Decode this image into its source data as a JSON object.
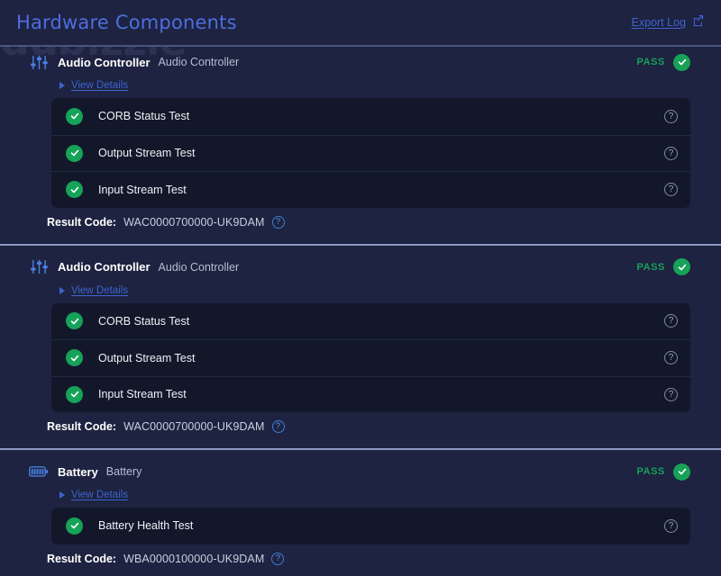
{
  "watermark": {
    "text": "dubizzle"
  },
  "header": {
    "title": "Hardware Components",
    "export_label": "Export Log",
    "export_icon": "external-link-icon"
  },
  "colors": {
    "background": "#1d2340",
    "panel": "#121829",
    "accent_link": "#3f63cf",
    "title": "#4f6de0",
    "pass_green": "#17a257",
    "divider": "#8e9ac4"
  },
  "labels": {
    "result_code_label": "Result Code:",
    "view_details": "View Details",
    "help_glyph": "?"
  },
  "components": [
    {
      "icon": "sliders-icon",
      "name": "Audio Controller",
      "type": "Audio Controller",
      "status": "PASS",
      "result_code": "WAC0000700000-UK9DAM",
      "tests": [
        {
          "name": "CORB Status Test",
          "status": "PASS"
        },
        {
          "name": "Output Stream Test",
          "status": "PASS"
        },
        {
          "name": "Input Stream Test",
          "status": "PASS"
        }
      ]
    },
    {
      "icon": "sliders-icon",
      "name": "Audio Controller",
      "type": "Audio Controller",
      "status": "PASS",
      "result_code": "WAC0000700000-UK9DAM",
      "tests": [
        {
          "name": "CORB Status Test",
          "status": "PASS"
        },
        {
          "name": "Output Stream Test",
          "status": "PASS"
        },
        {
          "name": "Input Stream Test",
          "status": "PASS"
        }
      ]
    },
    {
      "icon": "battery-icon",
      "name": "Battery",
      "type": "Battery",
      "status": "PASS",
      "result_code": "WBA0000100000-UK9DAM",
      "tests": [
        {
          "name": "Battery Health Test",
          "status": "PASS"
        }
      ]
    }
  ]
}
